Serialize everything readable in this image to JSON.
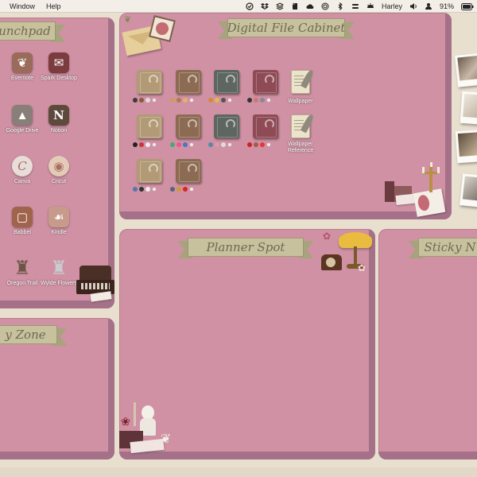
{
  "menubar": {
    "menus": [
      "Window",
      "Help"
    ],
    "user": "Harley",
    "battery": "91%"
  },
  "panels": {
    "launchpad": {
      "title": "unchpad"
    },
    "file_cabinet": {
      "title": "Digital File Cabinet"
    },
    "planner": {
      "title": "Planner Spot"
    },
    "sticky": {
      "title": "Sticky N"
    },
    "cozy": {
      "title": "y Zone"
    }
  },
  "apps": [
    {
      "label": "Evernote",
      "icon": "evernote-icon",
      "color": "#9a6a5a"
    },
    {
      "label": "Spark Desktop",
      "icon": "spark-icon",
      "color": "#7b3b3f"
    },
    {
      "label": "Google Drive",
      "icon": "google-drive-icon",
      "color": "#8a7f78"
    },
    {
      "label": "Notion",
      "icon": "notion-icon",
      "color": "#5e4a3d"
    },
    {
      "label": "Canva",
      "icon": "canva-icon",
      "color": "#b9908e"
    },
    {
      "label": "Cricut",
      "icon": "cricut-icon",
      "color": "#a96e62"
    },
    {
      "label": "Babbel",
      "icon": "babbel-icon",
      "color": "#a0634c"
    },
    {
      "label": "Kindle",
      "icon": "kindle-icon",
      "color": "#b27b6e"
    },
    {
      "label": "Oregon Trail",
      "icon": "chess-rook-icon",
      "color": "#6e5647"
    },
    {
      "label": "Wylde Flowers",
      "icon": "chess-rook-icon",
      "color": "#aeb0b5"
    }
  ],
  "cabinet": {
    "wallpaper_label": "Wallpaper",
    "wallpaper_reference_label": "Wallpaper Reference"
  },
  "colors": {
    "desktop": "#e9dfcf",
    "panel": "#cf91a3",
    "panel_shadow": "#a57189",
    "ribbon": "#c7c19d",
    "folder_tan": "#b29a76",
    "folder_brown": "#8c6b52",
    "folder_slate": "#5e6660",
    "folder_wine": "#8e4a55"
  }
}
